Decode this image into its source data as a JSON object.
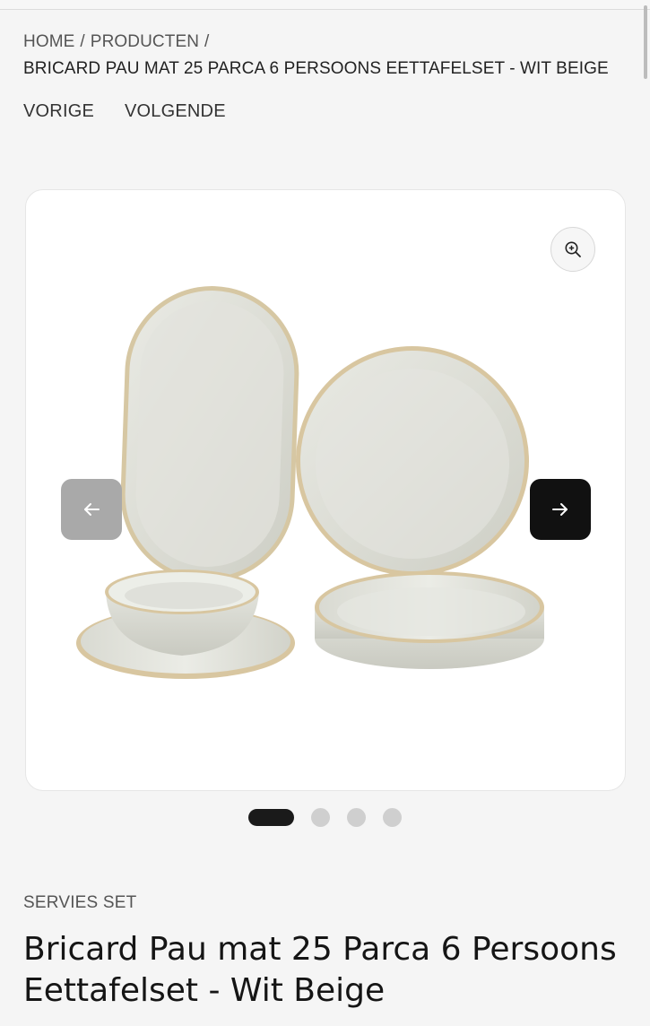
{
  "breadcrumb": {
    "home": "HOME",
    "separator": "/",
    "products": "PRODUCTEN",
    "current": "BRICARD PAU MAT 25 PARCA 6 PERSOONS EETTAFELSET - WIT BEIGE"
  },
  "nav": {
    "previous": "VORIGE",
    "next": "VOLGENDE"
  },
  "gallery": {
    "image_count": 4,
    "active_index": 0,
    "icons": {
      "zoom": "zoom-in-icon",
      "prev": "arrow-left-icon",
      "next": "arrow-right-icon"
    },
    "colors": {
      "prev_button": "#a9a9a9",
      "next_button": "#111111",
      "active_dot": "#1a1a1a",
      "inactive_dot": "#cfcfcf"
    }
  },
  "product": {
    "category": "SERVIES SET",
    "title": "Bricard Pau mat 25 Parca 6 Persoons Eettafelset - Wit Beige"
  }
}
